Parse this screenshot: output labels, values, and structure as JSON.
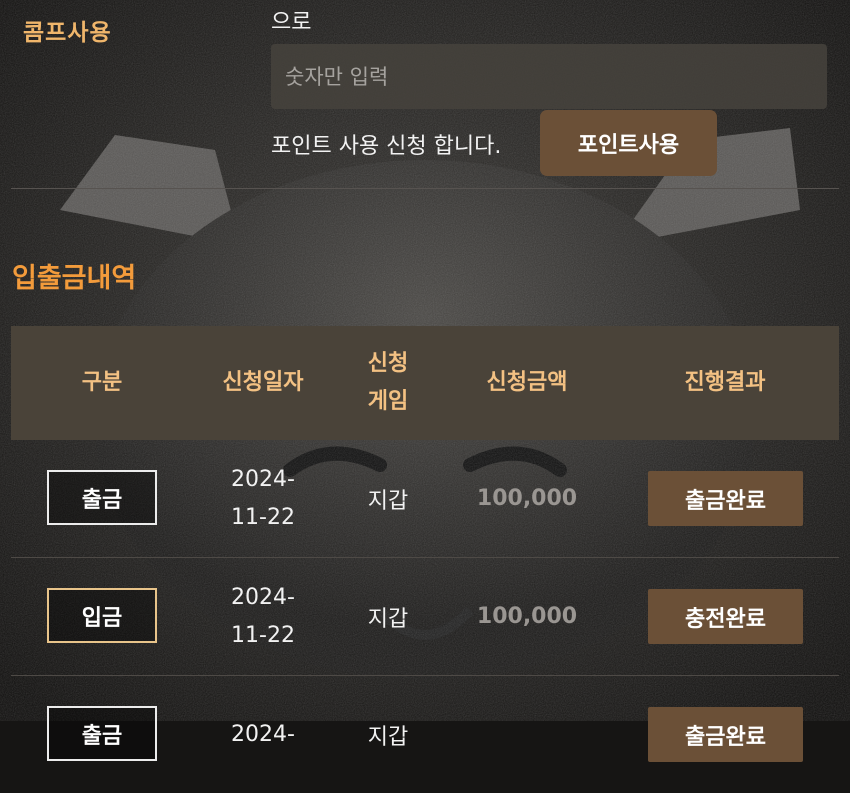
{
  "comp": {
    "label": "콤프사용",
    "prefix_text": "으로",
    "input_value": "",
    "input_placeholder": "숫자만 입력",
    "apply_text": "포인트 사용 신청 합니다.",
    "button_label": "포인트사용"
  },
  "history": {
    "title": "입출금내역",
    "columns": [
      {
        "line1": "구분",
        "line2": ""
      },
      {
        "line1": "신청일자",
        "line2": ""
      },
      {
        "line1": "신청",
        "line2": "게임"
      },
      {
        "line1": "신청금액",
        "line2": ""
      },
      {
        "line1": "진행결과",
        "line2": ""
      }
    ],
    "rows": [
      {
        "type": "출금",
        "date_line1": "2024-",
        "date_line2": "11-22",
        "game": "지갑",
        "amount": "100,000",
        "result": "출금완료"
      },
      {
        "type": "입금",
        "date_line1": "2024-",
        "date_line2": "11-22",
        "game": "지갑",
        "amount": "100,000",
        "result": "충전완료"
      },
      {
        "type": "출금",
        "date_line1": "2024-",
        "date_line2": "",
        "game": "지갑",
        "amount": "",
        "result": "출금완료"
      }
    ]
  },
  "colors": {
    "accent_orange": "#f39b3b",
    "label_gold": "#f0b66b",
    "header_text": "#f3c183",
    "button_brown": "#6b5037",
    "table_header_bg": "#4a4339"
  }
}
